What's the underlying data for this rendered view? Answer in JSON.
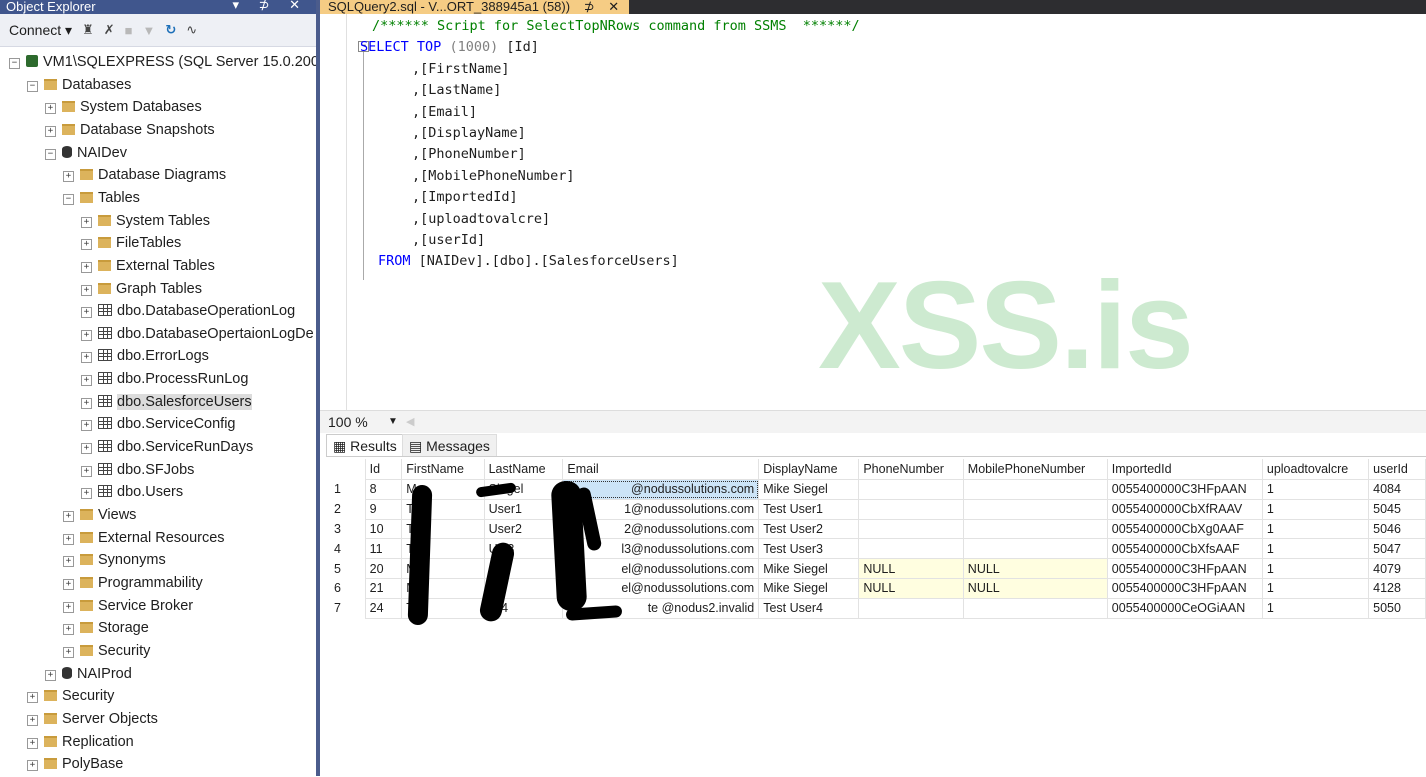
{
  "object_explorer": {
    "title": "Object Explorer",
    "title_buttons": "▾ ⊅ ✕",
    "toolbar": {
      "connect_label": "Connect"
    },
    "tree": [
      {
        "label": "VM1\\SQLEXPRESS (SQL Server 15.0.2000",
        "icon": "server",
        "exp": "−",
        "level": 0
      },
      {
        "label": "Databases",
        "icon": "folder",
        "exp": "−",
        "level": 1
      },
      {
        "label": "System Databases",
        "icon": "folder",
        "exp": "+",
        "level": 2
      },
      {
        "label": "Database Snapshots",
        "icon": "folder",
        "exp": "+",
        "level": 2
      },
      {
        "label": "NAIDev",
        "icon": "db",
        "exp": "−",
        "level": 2
      },
      {
        "label": "Database Diagrams",
        "icon": "folder",
        "exp": "+",
        "level": 3
      },
      {
        "label": "Tables",
        "icon": "folder",
        "exp": "−",
        "level": 3
      },
      {
        "label": "System Tables",
        "icon": "folder",
        "exp": "+",
        "level": 4
      },
      {
        "label": "FileTables",
        "icon": "folder",
        "exp": "+",
        "level": 4
      },
      {
        "label": "External Tables",
        "icon": "folder",
        "exp": "+",
        "level": 4
      },
      {
        "label": "Graph Tables",
        "icon": "folder",
        "exp": "+",
        "level": 4
      },
      {
        "label": "dbo.DatabaseOperationLog",
        "icon": "table",
        "exp": "+",
        "level": 4
      },
      {
        "label": "dbo.DatabaseOpertaionLogDe",
        "icon": "table",
        "exp": "+",
        "level": 4
      },
      {
        "label": "dbo.ErrorLogs",
        "icon": "table",
        "exp": "+",
        "level": 4
      },
      {
        "label": "dbo.ProcessRunLog",
        "icon": "table",
        "exp": "+",
        "level": 4
      },
      {
        "label": "dbo.SalesforceUsers",
        "icon": "table",
        "exp": "+",
        "level": 4,
        "selected": true
      },
      {
        "label": "dbo.ServiceConfig",
        "icon": "table",
        "exp": "+",
        "level": 4
      },
      {
        "label": "dbo.ServiceRunDays",
        "icon": "table",
        "exp": "+",
        "level": 4
      },
      {
        "label": "dbo.SFJobs",
        "icon": "table",
        "exp": "+",
        "level": 4
      },
      {
        "label": "dbo.Users",
        "icon": "table",
        "exp": "+",
        "level": 4
      },
      {
        "label": "Views",
        "icon": "folder",
        "exp": "+",
        "level": 3
      },
      {
        "label": "External Resources",
        "icon": "folder",
        "exp": "+",
        "level": 3
      },
      {
        "label": "Synonyms",
        "icon": "folder",
        "exp": "+",
        "level": 3
      },
      {
        "label": "Programmability",
        "icon": "folder",
        "exp": "+",
        "level": 3
      },
      {
        "label": "Service Broker",
        "icon": "folder",
        "exp": "+",
        "level": 3
      },
      {
        "label": "Storage",
        "icon": "folder",
        "exp": "+",
        "level": 3
      },
      {
        "label": "Security",
        "icon": "folder",
        "exp": "+",
        "level": 3
      },
      {
        "label": "NAIProd",
        "icon": "db",
        "exp": "+",
        "level": 2
      },
      {
        "label": "Security",
        "icon": "folder",
        "exp": "+",
        "level": 1
      },
      {
        "label": "Server Objects",
        "icon": "folder",
        "exp": "+",
        "level": 1
      },
      {
        "label": "Replication",
        "icon": "folder",
        "exp": "+",
        "level": 1
      },
      {
        "label": "PolyBase",
        "icon": "folder",
        "exp": "+",
        "level": 1
      }
    ]
  },
  "editor": {
    "tab_label": "SQLQuery2.sql - V...ORT_388945a1 (58))",
    "tab_pin": "⊅",
    "tab_close": "✕",
    "watermark": "XSS.is",
    "code": {
      "comment": "/****** Script for SelectTopNRows command from SSMS  ******/",
      "select_kw": "SELECT",
      "top_kw": "TOP",
      "top_n": "(1000)",
      "first_col": "[Id]",
      "columns": [
        ",[FirstName]",
        ",[LastName]",
        ",[Email]",
        ",[DisplayName]",
        ",[PhoneNumber]",
        ",[MobilePhoneNumber]",
        ",[ImportedId]",
        ",[uploadtovalcre]",
        ",[userId]"
      ],
      "from_kw": "FROM",
      "from_target": "[NAIDev].[dbo].[SalesforceUsers]"
    }
  },
  "zoom": {
    "level": "100 %"
  },
  "results": {
    "tabs": [
      "Results",
      "Messages"
    ],
    "columns": [
      "",
      "Id",
      "FirstName",
      "LastName",
      "Email",
      "DisplayName",
      "PhoneNumber",
      "MobilePhoneNumber",
      "ImportedId",
      "uploadtovalcre",
      "userId"
    ],
    "rows": [
      [
        "1",
        "8",
        "M",
        "Siegel",
        "@nodussolutions.com",
        "Mike Siegel",
        "",
        "",
        "0055400000C3HFpAAN",
        "1",
        "4084"
      ],
      [
        "2",
        "9",
        "T",
        "User1",
        "1@nodussolutions.com",
        "Test User1",
        "",
        "",
        "0055400000CbXfRAAV",
        "1",
        "5045"
      ],
      [
        "3",
        "10",
        "T",
        "User2",
        "2@nodussolutions.com",
        "Test User2",
        "",
        "",
        "0055400000CbXg0AAF",
        "1",
        "5046"
      ],
      [
        "4",
        "11",
        "T",
        "Us 3",
        "l3@nodussolutions.com",
        "Test User3",
        "",
        "",
        "0055400000CbXfsAAF",
        "1",
        "5047"
      ],
      [
        "5",
        "20",
        "M",
        "S",
        "el@nodussolutions.com",
        "Mike Siegel",
        "NULL",
        "NULL",
        "0055400000C3HFpAAN",
        "1",
        "4079"
      ],
      [
        "6",
        "21",
        "M e",
        "Si",
        "el@nodussolutions.com",
        "Mike Siegel",
        "NULL",
        "NULL",
        "0055400000C3HFpAAN",
        "1",
        "4128"
      ],
      [
        "7",
        "24",
        "T t",
        "U 4",
        "te @nodus2.invalid",
        "Test User4",
        "",
        "",
        "0055400000CeOGiAAN",
        "1",
        "5050"
      ]
    ]
  }
}
